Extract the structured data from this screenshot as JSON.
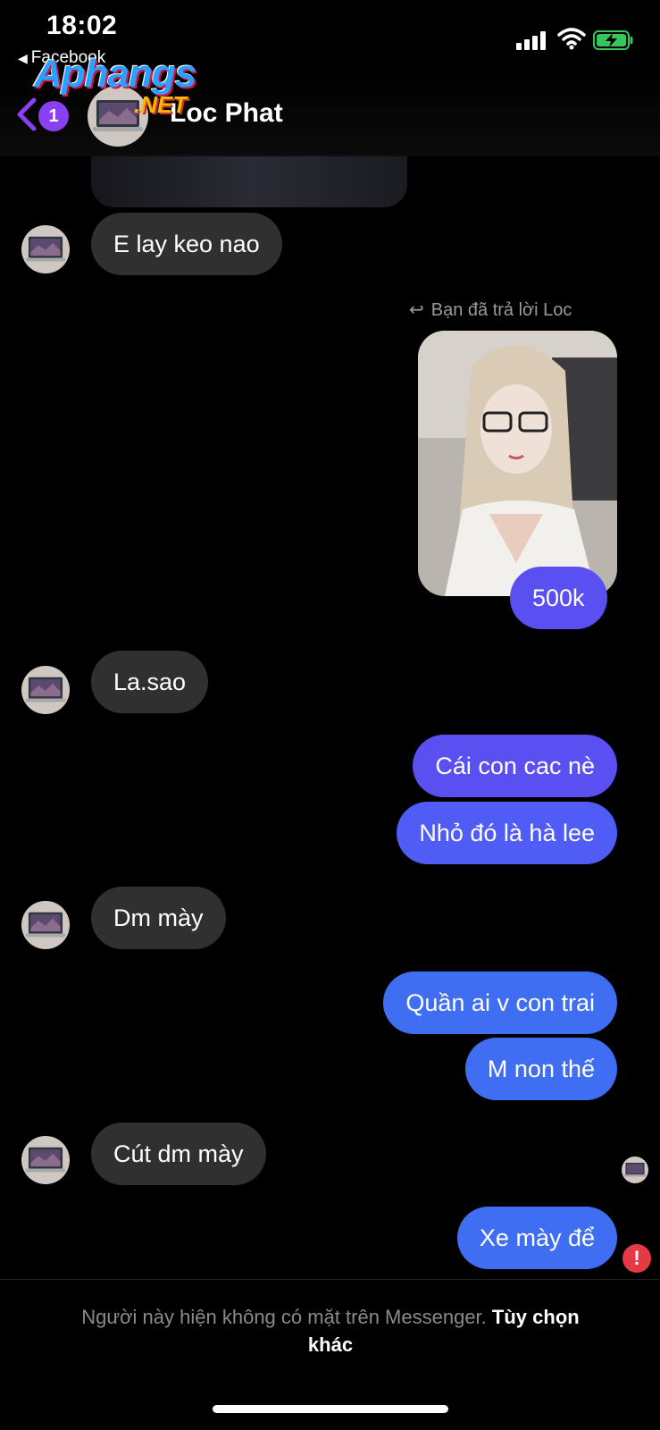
{
  "status_bar": {
    "time": "18:02",
    "back_app": "Facebook"
  },
  "watermark": {
    "main": "Aphangs",
    "suffix": ".NET"
  },
  "header": {
    "unread_count": "1",
    "contact_name": "Loc Phat"
  },
  "reply_note": "Bạn đã trả lời Loc",
  "messages": [
    {
      "side": "in",
      "text": "E lay keo nao"
    },
    {
      "side": "out",
      "text": "500k"
    },
    {
      "side": "in",
      "text": "La.sao"
    },
    {
      "side": "out",
      "text": "Cái con cac nè"
    },
    {
      "side": "out",
      "text": "Nhỏ đó là hà lee"
    },
    {
      "side": "in",
      "text": "Dm mày"
    },
    {
      "side": "out",
      "text": "Quần ai v con trai"
    },
    {
      "side": "out",
      "text": "M non thế"
    },
    {
      "side": "in",
      "text": "Cút dm mày"
    },
    {
      "side": "out",
      "text": "Xe mày để"
    }
  ],
  "footer": {
    "notice": "Người này hiện không có mặt trên Messenger.",
    "option": "Tùy chọn khác"
  },
  "colors": {
    "incoming_bubble": "#303030",
    "outgoing_bubble": "#4f5cf5",
    "badge": "#8a3ff0",
    "error": "#e53946"
  },
  "icons": [
    "back-chevron-icon",
    "reply-arrow-icon",
    "error-icon",
    "signal-icon",
    "wifi-icon",
    "battery-charging-icon"
  ]
}
